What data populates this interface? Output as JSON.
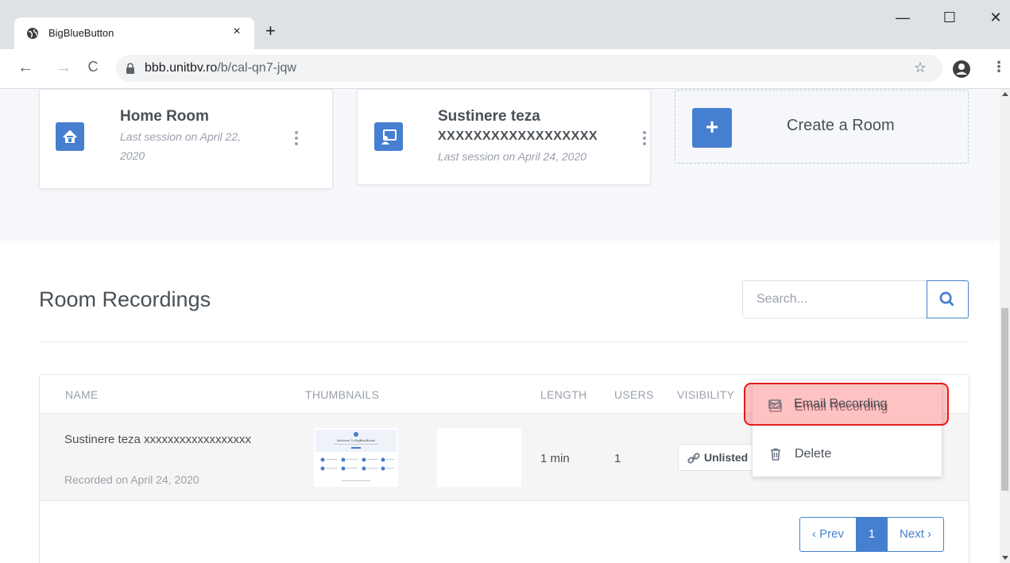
{
  "browser": {
    "tab_title": "BigBlueButton",
    "tab_close": "×",
    "new_tab": "+",
    "url_host": "bbb.unitbv.ro",
    "url_path": "/b/cal-qn7-jqw",
    "back": "←",
    "forward": "→",
    "reload": "C",
    "star": "☆",
    "menu": "⋮",
    "win_min": "—",
    "win_max": "☐",
    "win_close": "✕"
  },
  "rooms": [
    {
      "name": "Home Room",
      "subtitle": "Last session on April 22, 2020",
      "icon": "home-icon"
    },
    {
      "name": "Sustinere teza",
      "name_line2": "XXXXXXXXXXXXXXXXXX",
      "subtitle": "Last session on April 24, 2020",
      "icon": "presentation-icon"
    }
  ],
  "create_room": {
    "plus": "+",
    "label": "Create a Room"
  },
  "recordings": {
    "title": "Room Recordings",
    "search_placeholder": "Search...",
    "columns": {
      "name": "NAME",
      "thumbnails": "THUMBNAILS",
      "length": "LENGTH",
      "users": "USERS",
      "visibility": "VISIBILITY"
    },
    "rows": [
      {
        "name": "Sustinere teza xxxxxxxxxxxxxxxxxx",
        "recorded": "Recorded on April 24, 2020",
        "length": "1 min",
        "users": "1",
        "visibility": "Unlisted",
        "thumbnail_text": "Welcome To BigBlueButton"
      }
    ],
    "menu": [
      {
        "label": "Email Recording",
        "icon": "envelope-icon"
      },
      {
        "label": "Delete",
        "icon": "trash-icon"
      }
    ],
    "pager": {
      "prev": "‹ Prev",
      "current": "1",
      "next": "Next ›"
    }
  },
  "colors": {
    "accent": "#467fcf",
    "highlight": "#e21d1d"
  }
}
